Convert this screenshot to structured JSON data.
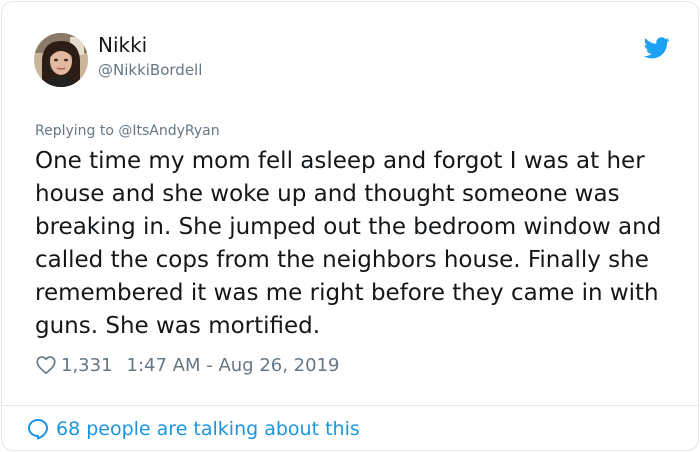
{
  "author": {
    "name": "Nikki",
    "handle": "@NikkiBordell"
  },
  "tweet": {
    "replying_to": "Replying to @ItsAndyRyan",
    "text": "One time my mom fell asleep and forgot I was at her house and she woke up and thought someone was breaking in. She jumped out the bedroom window and called the cops from the neighbors house. Finally she remembered it was me right before they came in with guns. She was mortified.",
    "likes": "1,331",
    "timestamp": "1:47 AM - Aug 26, 2019"
  },
  "footer": {
    "talking": "68 people are talking about this"
  },
  "icons": {
    "brand": "twitter-bird-icon",
    "like": "heart-icon",
    "comments": "speech-bubble-icon"
  },
  "colors": {
    "brand_blue": "#1da1f2",
    "link_blue": "#1b95e0",
    "muted": "#657786",
    "text": "#14171a"
  }
}
